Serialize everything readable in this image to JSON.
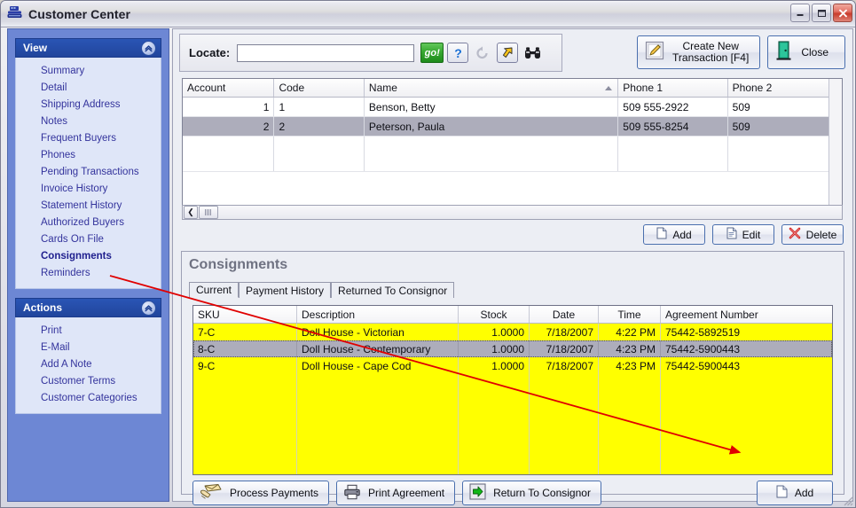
{
  "window": {
    "title": "Customer Center",
    "icon": "cash-register-icon",
    "minimize_label": "Minimize",
    "maximize_label": "Maximize",
    "close_label": "Close"
  },
  "sidebar": {
    "view_panel": {
      "title": "View",
      "collapse_icon": "chevron-up-icon",
      "items": [
        {
          "label": "Summary",
          "active": false
        },
        {
          "label": "Detail",
          "active": false
        },
        {
          "label": "Shipping Address",
          "active": false
        },
        {
          "label": "Notes",
          "active": false
        },
        {
          "label": "Frequent Buyers",
          "active": false
        },
        {
          "label": "Phones",
          "active": false
        },
        {
          "label": "Pending Transactions",
          "active": false
        },
        {
          "label": "Invoice History",
          "active": false
        },
        {
          "label": "Statement History",
          "active": false
        },
        {
          "label": "Authorized Buyers",
          "active": false
        },
        {
          "label": "Cards On File",
          "active": false
        },
        {
          "label": "Consignments",
          "active": true
        },
        {
          "label": "Reminders",
          "active": false
        }
      ]
    },
    "actions_panel": {
      "title": "Actions",
      "collapse_icon": "chevron-up-icon",
      "items": [
        {
          "label": "Print"
        },
        {
          "label": "E-Mail"
        },
        {
          "label": "Add A Note"
        },
        {
          "label": "Customer Terms"
        },
        {
          "label": "Customer Categories"
        }
      ]
    }
  },
  "toolbar": {
    "locate_label": "Locate:",
    "locate_value": "",
    "locate_placeholder": "",
    "go_label": "go!",
    "help_icon": "question-mark-icon",
    "refresh_icon": "refresh-arrow-icon",
    "jump_icon": "yellow-arrow-icon",
    "find_icon": "binoculars-icon",
    "create_transaction_label": "Create New\nTransaction [F4]",
    "create_transaction_icon": "edit-document-icon",
    "close_label": "Close",
    "close_icon": "exit-door-icon"
  },
  "customer_grid": {
    "columns": [
      "Account",
      "Code",
      "Name",
      "Phone 1",
      "Phone 2"
    ],
    "sorted_column": "Name",
    "sort_direction": "ascending",
    "rows": [
      {
        "account": "1",
        "code": "1",
        "name": "Benson, Betty",
        "phone1": "509  555-2922",
        "phone2": "509",
        "selected": false
      },
      {
        "account": "2",
        "code": "2",
        "name": "Peterson, Paula",
        "phone1": "509  555-8254",
        "phone2": "509",
        "selected": true
      }
    ],
    "scroll_left_icon": "scroll-left-arrow-icon",
    "scroll_right_icon": "scroll-right-arrow-icon",
    "buttons": [
      {
        "label": "Add",
        "icon": "new-document-icon"
      },
      {
        "label": "Edit",
        "icon": "edit-document-icon"
      },
      {
        "label": "Delete",
        "icon": "red-x-icon"
      }
    ]
  },
  "consignments": {
    "title": "Consignments",
    "tabs": [
      {
        "label": "Current",
        "active": true
      },
      {
        "label": "Payment History",
        "active": false
      },
      {
        "label": "Returned To Consignor",
        "active": false
      }
    ],
    "columns": [
      "SKU",
      "Description",
      "Stock",
      "Date",
      "Time",
      "Agreement Number"
    ],
    "rows": [
      {
        "sku": "7-C",
        "description": "Doll House - Victorian",
        "stock": "1.0000",
        "date": "7/18/2007",
        "time": "4:22 PM",
        "agreement": "75442-5892519",
        "selected": false
      },
      {
        "sku": "8-C",
        "description": "Doll House - Contemporary",
        "stock": "1.0000",
        "date": "7/18/2007",
        "time": "4:23 PM",
        "agreement": "75442-5900443",
        "selected": true
      },
      {
        "sku": "9-C",
        "description": "Doll House - Cape Cod",
        "stock": "1.0000",
        "date": "7/18/2007",
        "time": "4:23 PM",
        "agreement": "75442-5900443",
        "selected": false
      }
    ],
    "buttons": [
      {
        "label": "Process Payments",
        "icon": "money-hand-icon"
      },
      {
        "label": "Print Agreement",
        "icon": "printer-icon"
      },
      {
        "label": "Return To Consignor",
        "icon": "green-arrow-right-icon"
      }
    ],
    "add_button": {
      "label": "Add",
      "icon": "new-document-icon"
    }
  },
  "annotation": {
    "color": "#e00000",
    "from": "Consignments sidebar item",
    "to": "Consignments Add button"
  }
}
